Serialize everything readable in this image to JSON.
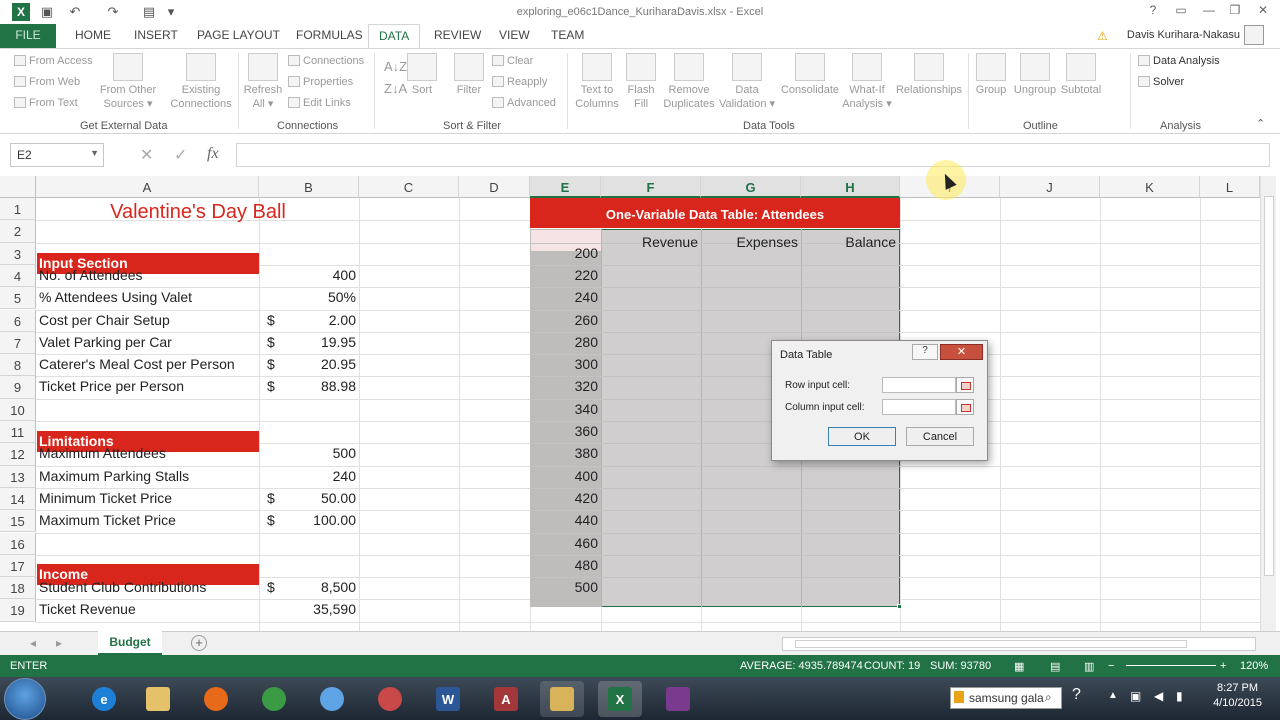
{
  "window": {
    "title": "exploring_e06c1Dance_KuriharaDavis.xlsx - Excel",
    "user": "Davis Kurihara-Nakasu",
    "controls": [
      "?",
      "▭",
      "—",
      "❐",
      "✕"
    ]
  },
  "ribbon_tabs": [
    "FILE",
    "HOME",
    "INSERT",
    "PAGE LAYOUT",
    "FORMULAS",
    "DATA",
    "REVIEW",
    "VIEW",
    "TEAM"
  ],
  "active_tab": "DATA",
  "ribbon": {
    "get_external": {
      "from_access": "From Access",
      "from_web": "From Web",
      "from_text": "From Text",
      "from_other_1": "From Other",
      "from_other_2": "Sources ▾",
      "existing_1": "Existing",
      "existing_2": "Connections",
      "label": "Get External Data"
    },
    "connections": {
      "refresh_1": "Refresh",
      "refresh_2": "All ▾",
      "connections": "Connections",
      "properties": "Properties",
      "edit_links": "Edit Links",
      "label": "Connections"
    },
    "sort_filter": {
      "sort": "Sort",
      "filter": "Filter",
      "clear": "Clear",
      "reapply": "Reapply",
      "advanced": "Advanced",
      "label": "Sort & Filter"
    },
    "data_tools": {
      "text_to_columns_1": "Text to",
      "text_to_columns_2": "Columns",
      "flash_fill_1": "Flash",
      "flash_fill_2": "Fill",
      "remove_dup_1": "Remove",
      "remove_dup_2": "Duplicates",
      "validation_1": "Data",
      "validation_2": "Validation ▾",
      "consolidate": "Consolidate",
      "whatif_1": "What-If",
      "whatif_2": "Analysis ▾",
      "relationships": "Relationships",
      "label": "Data Tools"
    },
    "outline": {
      "group": "Group",
      "ungroup": "Ungroup",
      "subtotal": "Subtotal",
      "label": "Outline"
    },
    "analysis": {
      "data_analysis": "Data Analysis",
      "solver": "Solver",
      "label": "Analysis"
    }
  },
  "formula_bar": {
    "name_box": "E2",
    "fx": "fx",
    "value": ""
  },
  "columns": [
    "A",
    "B",
    "C",
    "D",
    "E",
    "F",
    "G",
    "H",
    "I",
    "J",
    "K",
    "L"
  ],
  "selected_columns": [
    "E",
    "F",
    "G",
    "H"
  ],
  "rows": [
    "1",
    "2",
    "3",
    "4",
    "5",
    "6",
    "7",
    "8",
    "9",
    "10",
    "11",
    "12",
    "13",
    "14",
    "15",
    "16",
    "17",
    "18",
    "19"
  ],
  "sheet": {
    "title": "Valentine's Day Ball",
    "input_section": "Input Section",
    "limitations": "Limitations",
    "income": "Income",
    "left_rows": [
      {
        "row": 4,
        "label": "No. of Attendees",
        "cur": "",
        "value": "400"
      },
      {
        "row": 5,
        "label": "% Attendees Using Valet",
        "cur": "",
        "value": "50%"
      },
      {
        "row": 6,
        "label": "Cost per Chair Setup",
        "cur": "$",
        "value": "2.00"
      },
      {
        "row": 7,
        "label": "Valet Parking per Car",
        "cur": "$",
        "value": "19.95"
      },
      {
        "row": 8,
        "label": "Caterer's Meal Cost per Person",
        "cur": "$",
        "value": "20.95"
      },
      {
        "row": 9,
        "label": "Ticket Price per Person",
        "cur": "$",
        "value": "88.98"
      },
      {
        "row": 12,
        "label": "Maximum Attendees",
        "cur": "",
        "value": "500"
      },
      {
        "row": 13,
        "label": "Maximum Parking Stalls",
        "cur": "",
        "value": "240"
      },
      {
        "row": 14,
        "label": "Minimum Ticket Price",
        "cur": "$",
        "value": "50.00"
      },
      {
        "row": 15,
        "label": "Maximum Ticket Price",
        "cur": "$",
        "value": "100.00"
      },
      {
        "row": 18,
        "label": "Student Club Contributions",
        "cur": "$",
        "value": "8,500"
      },
      {
        "row": 19,
        "label": "Ticket Revenue",
        "cur": "",
        "value": "35,590"
      }
    ],
    "data_table_title": "One-Variable Data Table: Attendees",
    "data_table_headers": [
      "Revenue",
      "Expenses",
      "Balance"
    ],
    "attendee_values": [
      "200",
      "220",
      "240",
      "260",
      "280",
      "300",
      "320",
      "340",
      "360",
      "380",
      "400",
      "420",
      "440",
      "460",
      "480",
      "500"
    ]
  },
  "sheet_tabs": {
    "active": "Budget",
    "add": "+"
  },
  "status": {
    "mode": "ENTER",
    "average": "AVERAGE: 4935.789474",
    "count": "COUNT: 19",
    "sum": "SUM: 93780",
    "zoom": "120%"
  },
  "dialog": {
    "title": "Data Table",
    "help": "?",
    "close": "✕",
    "row_input_label": "Row input cell:",
    "col_input_label": "Column input cell:",
    "row_input_value": "",
    "col_input_value": "",
    "ok": "OK",
    "cancel": "Cancel"
  },
  "taskbar": {
    "search_text": "samsung gala",
    "time": "8:27 PM",
    "date": "4/10/2015"
  },
  "colors": {
    "excel_green": "#217346",
    "header_red": "#d9261c"
  }
}
